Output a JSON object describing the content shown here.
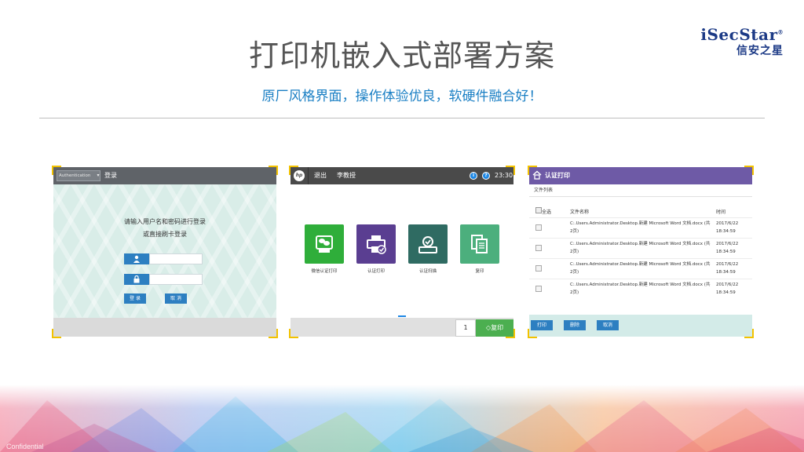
{
  "slide": {
    "title": "打印机嵌入式部署方案",
    "subtitle": "原厂风格界面，操作体验优良，软硬件融合好！",
    "confidential": "Confidential"
  },
  "logo": {
    "brand_en": "iSecStar",
    "registered": "®",
    "brand_cn": "信安之星"
  },
  "login_panel": {
    "auth_select": "Authentication",
    "title": "登录",
    "prompt_line1": "请输入用户名和密码进行登录",
    "prompt_line2": "或直接刷卡登录",
    "username_value": "",
    "password_value": "",
    "login_button": "登 录",
    "cancel_button": "取 消"
  },
  "home_panel": {
    "hp_logo": "hp",
    "logout": "退出",
    "user_name": "李教授",
    "info_icon": "i",
    "help_icon": "?",
    "time": "23:30",
    "tiles": [
      {
        "label": "微信认证打印",
        "color": "#2fae3a",
        "icon": "wechat-print-icon"
      },
      {
        "label": "认证打印",
        "color": "#5a3e91",
        "icon": "printer-check-icon"
      },
      {
        "label": "认证扫描",
        "color": "#2f6b62",
        "icon": "scanner-check-icon"
      },
      {
        "label": "复印",
        "color": "#4caf7d",
        "icon": "copy-icon"
      }
    ],
    "copies": "1",
    "copy_button": "复印"
  },
  "print_panel": {
    "title": "认证打印",
    "file_list_label": "文件列表",
    "columns": {
      "select_all": "全选",
      "file_name": "文件名称",
      "time": "时间"
    },
    "rows": [
      {
        "name": "C:.Users.Administrator.Desktop.新建 Microsoft Word 文档.docx (共2页)",
        "date": "2017/6/22",
        "clock": "18:34:59"
      },
      {
        "name": "C:.Users.Administrator.Desktop.新建 Microsoft Word 文档.docx (共2页)",
        "date": "2017/6/22",
        "clock": "18:34:59"
      },
      {
        "name": "C:.Users.Administrator.Desktop.新建 Microsoft Word 文档.docx (共2页)",
        "date": "2017/6/22",
        "clock": "18:34:59"
      },
      {
        "name": "C:.Users.Administrator.Desktop.新建 Microsoft Word 文档.docx (共2页)",
        "date": "2017/6/22",
        "clock": "18:34:59"
      }
    ],
    "print_button": "打印",
    "delete_button": "删除",
    "cancel_button": "取消"
  },
  "colors": {
    "accent_yellow": "#f2c200",
    "title_blue": "#1a7fc4",
    "brand_blue": "#1c3a86",
    "purple": "#6e5aa6",
    "green": "#4caf50"
  }
}
